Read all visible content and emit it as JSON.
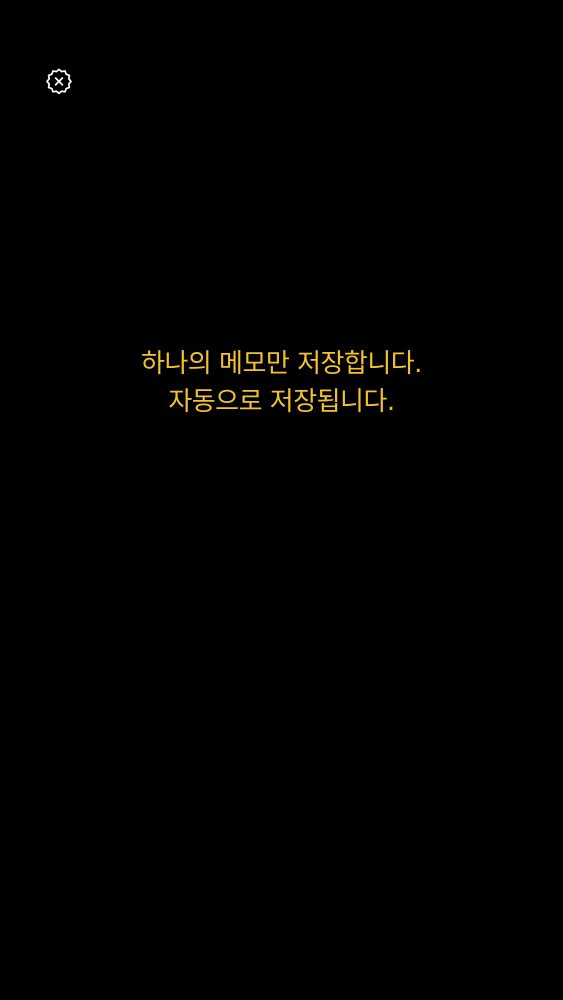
{
  "header": {
    "settings_icon": "settings-gear-x-icon"
  },
  "main": {
    "message_line_1": "하나의 메모만 저장합니다.",
    "message_line_2": "자동으로 저장됩니다."
  },
  "colors": {
    "background": "#000000",
    "accent_text": "#F2C230",
    "icon": "#FFFFFF"
  }
}
